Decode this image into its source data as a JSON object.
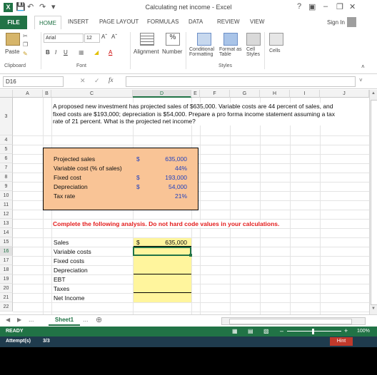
{
  "titlebar": {
    "title": "Calculating net income - Excel",
    "help": "?",
    "sign_in": "Sign In"
  },
  "tabs": [
    "FILE",
    "HOME",
    "INSERT",
    "PAGE LAYOUT",
    "FORMULAS",
    "DATA",
    "REVIEW",
    "VIEW"
  ],
  "ribbon": {
    "paste": "Paste",
    "clipboard": "Clipboard",
    "font_name": "Arial",
    "font_size": "12",
    "font_group": "Font",
    "bold": "B",
    "italic": "I",
    "underline": "U",
    "alignment": "Alignment",
    "number": "Number",
    "conditional": "Conditional",
    "formatting": "Formatting",
    "format_as": "Format as",
    "table": "Table",
    "cell": "Cell",
    "styles_btn": "Styles",
    "styles_group": "Styles",
    "cells": "Cells"
  },
  "formula_bar": {
    "name_box": "D16",
    "fx": "fx",
    "cancel": "✕",
    "enter": "✓"
  },
  "columns": [
    "A",
    "B",
    "C",
    "D",
    "E",
    "F",
    "G",
    "H",
    "I",
    "J"
  ],
  "rows": [
    "3",
    "4",
    "5",
    "6",
    "7",
    "8",
    "9",
    "10",
    "11",
    "12",
    "13",
    "14",
    "15",
    "16",
    "17",
    "18",
    "19",
    "20",
    "21",
    "22"
  ],
  "prompt": "A proposed new investment has projected sales of $635,000. Variable costs are 44 percent of sales, and fixed costs are $193,000; depreciation is $54,000. Prepare a pro forma income statement assuming a tax rate of 21 percent. What is the projected net income?",
  "inputs": [
    {
      "label": "Projected sales",
      "currency": "$",
      "value": "635,000"
    },
    {
      "label": "Variable cost (% of sales)",
      "currency": "",
      "value": "44%"
    },
    {
      "label": "Fixed cost",
      "currency": "$",
      "value": "193,000"
    },
    {
      "label": "Depreciation",
      "currency": "$",
      "value": "54,000"
    },
    {
      "label": "Tax rate",
      "currency": "",
      "value": "21%"
    }
  ],
  "instruction": "Complete the following analysis. Do not hard code values in your calculations.",
  "analysis": [
    {
      "label": "Sales",
      "currency": "$",
      "value": "635,000"
    },
    {
      "label": "Variable costs",
      "currency": "",
      "value": ""
    },
    {
      "label": "Fixed costs",
      "currency": "",
      "value": ""
    },
    {
      "label": "Depreciation",
      "currency": "",
      "value": ""
    },
    {
      "label": "EBT",
      "currency": "",
      "value": ""
    },
    {
      "label": "Taxes",
      "currency": "",
      "value": ""
    },
    {
      "label": "Net Income",
      "currency": "",
      "value": ""
    }
  ],
  "sheet_tab": "Sheet1",
  "status": {
    "ready": "READY",
    "zoom": "100%"
  },
  "footer": {
    "attempts_label": "Attempt(s)",
    "attempts_value": "3/3",
    "hint": "Hint"
  },
  "colors": {
    "excel_green": "#217346",
    "input_fill": "#f9c496",
    "answer_fill": "#fff59d",
    "blue_text": "#1f3fbf",
    "red_text": "#e31c1c"
  }
}
